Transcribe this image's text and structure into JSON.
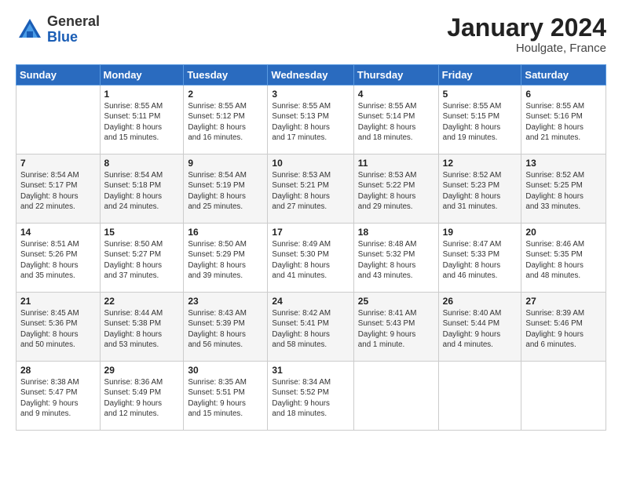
{
  "logo": {
    "general": "General",
    "blue": "Blue"
  },
  "title": "January 2024",
  "location": "Houlgate, France",
  "days_header": [
    "Sunday",
    "Monday",
    "Tuesday",
    "Wednesday",
    "Thursday",
    "Friday",
    "Saturday"
  ],
  "weeks": [
    [
      {
        "num": "",
        "info": ""
      },
      {
        "num": "1",
        "info": "Sunrise: 8:55 AM\nSunset: 5:11 PM\nDaylight: 8 hours\nand 15 minutes."
      },
      {
        "num": "2",
        "info": "Sunrise: 8:55 AM\nSunset: 5:12 PM\nDaylight: 8 hours\nand 16 minutes."
      },
      {
        "num": "3",
        "info": "Sunrise: 8:55 AM\nSunset: 5:13 PM\nDaylight: 8 hours\nand 17 minutes."
      },
      {
        "num": "4",
        "info": "Sunrise: 8:55 AM\nSunset: 5:14 PM\nDaylight: 8 hours\nand 18 minutes."
      },
      {
        "num": "5",
        "info": "Sunrise: 8:55 AM\nSunset: 5:15 PM\nDaylight: 8 hours\nand 19 minutes."
      },
      {
        "num": "6",
        "info": "Sunrise: 8:55 AM\nSunset: 5:16 PM\nDaylight: 8 hours\nand 21 minutes."
      }
    ],
    [
      {
        "num": "7",
        "info": "Sunrise: 8:54 AM\nSunset: 5:17 PM\nDaylight: 8 hours\nand 22 minutes."
      },
      {
        "num": "8",
        "info": "Sunrise: 8:54 AM\nSunset: 5:18 PM\nDaylight: 8 hours\nand 24 minutes."
      },
      {
        "num": "9",
        "info": "Sunrise: 8:54 AM\nSunset: 5:19 PM\nDaylight: 8 hours\nand 25 minutes."
      },
      {
        "num": "10",
        "info": "Sunrise: 8:53 AM\nSunset: 5:21 PM\nDaylight: 8 hours\nand 27 minutes."
      },
      {
        "num": "11",
        "info": "Sunrise: 8:53 AM\nSunset: 5:22 PM\nDaylight: 8 hours\nand 29 minutes."
      },
      {
        "num": "12",
        "info": "Sunrise: 8:52 AM\nSunset: 5:23 PM\nDaylight: 8 hours\nand 31 minutes."
      },
      {
        "num": "13",
        "info": "Sunrise: 8:52 AM\nSunset: 5:25 PM\nDaylight: 8 hours\nand 33 minutes."
      }
    ],
    [
      {
        "num": "14",
        "info": "Sunrise: 8:51 AM\nSunset: 5:26 PM\nDaylight: 8 hours\nand 35 minutes."
      },
      {
        "num": "15",
        "info": "Sunrise: 8:50 AM\nSunset: 5:27 PM\nDaylight: 8 hours\nand 37 minutes."
      },
      {
        "num": "16",
        "info": "Sunrise: 8:50 AM\nSunset: 5:29 PM\nDaylight: 8 hours\nand 39 minutes."
      },
      {
        "num": "17",
        "info": "Sunrise: 8:49 AM\nSunset: 5:30 PM\nDaylight: 8 hours\nand 41 minutes."
      },
      {
        "num": "18",
        "info": "Sunrise: 8:48 AM\nSunset: 5:32 PM\nDaylight: 8 hours\nand 43 minutes."
      },
      {
        "num": "19",
        "info": "Sunrise: 8:47 AM\nSunset: 5:33 PM\nDaylight: 8 hours\nand 46 minutes."
      },
      {
        "num": "20",
        "info": "Sunrise: 8:46 AM\nSunset: 5:35 PM\nDaylight: 8 hours\nand 48 minutes."
      }
    ],
    [
      {
        "num": "21",
        "info": "Sunrise: 8:45 AM\nSunset: 5:36 PM\nDaylight: 8 hours\nand 50 minutes."
      },
      {
        "num": "22",
        "info": "Sunrise: 8:44 AM\nSunset: 5:38 PM\nDaylight: 8 hours\nand 53 minutes."
      },
      {
        "num": "23",
        "info": "Sunrise: 8:43 AM\nSunset: 5:39 PM\nDaylight: 8 hours\nand 56 minutes."
      },
      {
        "num": "24",
        "info": "Sunrise: 8:42 AM\nSunset: 5:41 PM\nDaylight: 8 hours\nand 58 minutes."
      },
      {
        "num": "25",
        "info": "Sunrise: 8:41 AM\nSunset: 5:43 PM\nDaylight: 9 hours\nand 1 minute."
      },
      {
        "num": "26",
        "info": "Sunrise: 8:40 AM\nSunset: 5:44 PM\nDaylight: 9 hours\nand 4 minutes."
      },
      {
        "num": "27",
        "info": "Sunrise: 8:39 AM\nSunset: 5:46 PM\nDaylight: 9 hours\nand 6 minutes."
      }
    ],
    [
      {
        "num": "28",
        "info": "Sunrise: 8:38 AM\nSunset: 5:47 PM\nDaylight: 9 hours\nand 9 minutes."
      },
      {
        "num": "29",
        "info": "Sunrise: 8:36 AM\nSunset: 5:49 PM\nDaylight: 9 hours\nand 12 minutes."
      },
      {
        "num": "30",
        "info": "Sunrise: 8:35 AM\nSunset: 5:51 PM\nDaylight: 9 hours\nand 15 minutes."
      },
      {
        "num": "31",
        "info": "Sunrise: 8:34 AM\nSunset: 5:52 PM\nDaylight: 9 hours\nand 18 minutes."
      },
      {
        "num": "",
        "info": ""
      },
      {
        "num": "",
        "info": ""
      },
      {
        "num": "",
        "info": ""
      }
    ]
  ]
}
